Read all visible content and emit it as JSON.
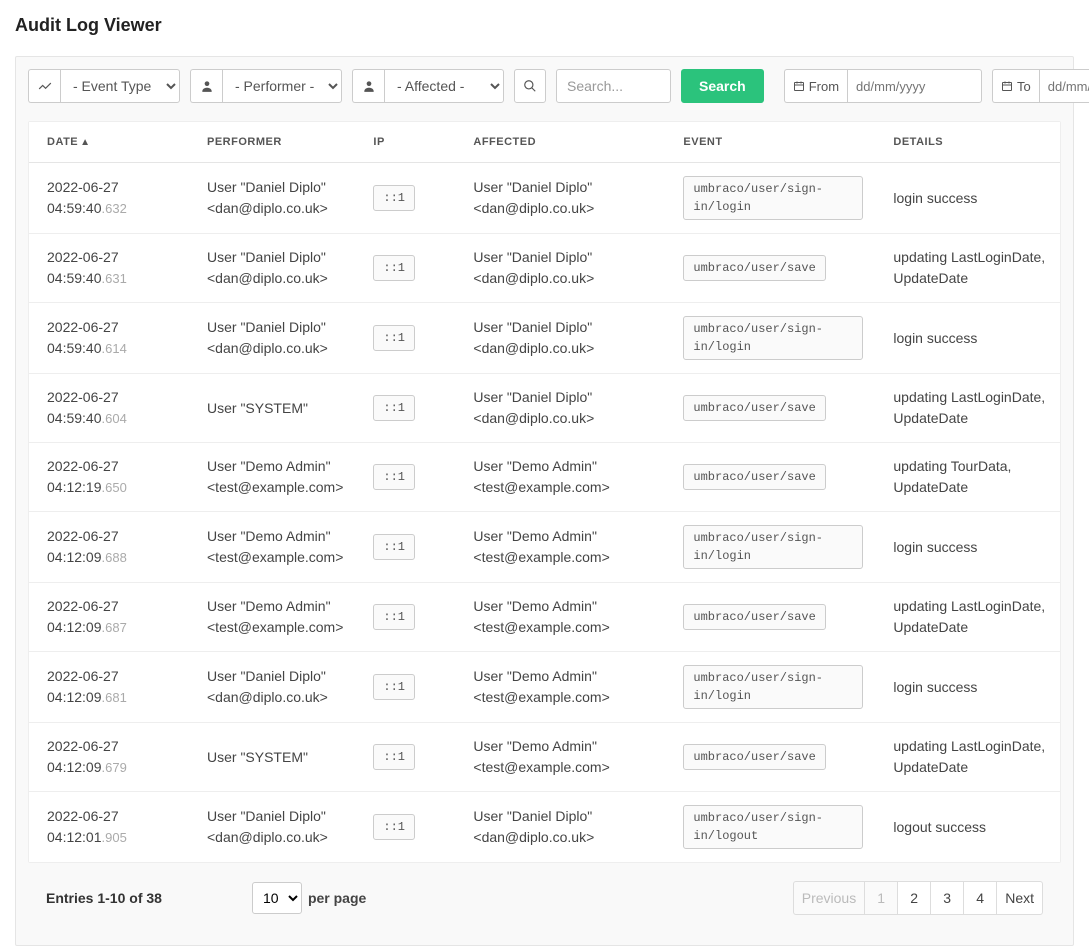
{
  "title": "Audit Log Viewer",
  "filters": {
    "eventType": "- Event Type -",
    "performer": "- Performer -",
    "affected": "- Affected -",
    "searchPlaceholder": "Search...",
    "searchButton": "Search",
    "fromLabel": "From",
    "toLabel": "To",
    "datePlaceholder": "dd/mm/yyyy"
  },
  "columns": {
    "date": "DATE",
    "performer": "PERFORMER",
    "ip": "IP",
    "affected": "AFFECTED",
    "event": "EVENT",
    "details": "DETAILS"
  },
  "rows": [
    {
      "date": "2022-06-27 04:59:40",
      "ms": ".632",
      "performer": "User \"Daniel Diplo\" <dan@diplo.co.uk>",
      "ip": "::1",
      "affected": "User \"Daniel Diplo\" <dan@diplo.co.uk>",
      "event": "umbraco/user/sign-in/login",
      "details": "login success"
    },
    {
      "date": "2022-06-27 04:59:40",
      "ms": ".631",
      "performer": "User \"Daniel Diplo\" <dan@diplo.co.uk>",
      "ip": "::1",
      "affected": "User \"Daniel Diplo\" <dan@diplo.co.uk>",
      "event": "umbraco/user/save",
      "details": "updating LastLoginDate, UpdateDate"
    },
    {
      "date": "2022-06-27 04:59:40",
      "ms": ".614",
      "performer": "User \"Daniel Diplo\" <dan@diplo.co.uk>",
      "ip": "::1",
      "affected": "User \"Daniel Diplo\" <dan@diplo.co.uk>",
      "event": "umbraco/user/sign-in/login",
      "details": "login success"
    },
    {
      "date": "2022-06-27 04:59:40",
      "ms": ".604",
      "performer": "User \"SYSTEM\"",
      "ip": "::1",
      "affected": "User \"Daniel Diplo\" <dan@diplo.co.uk>",
      "event": "umbraco/user/save",
      "details": "updating LastLoginDate, UpdateDate"
    },
    {
      "date": "2022-06-27 04:12:19",
      "ms": ".650",
      "performer": "User \"Demo Admin\" <test@example.com>",
      "ip": "::1",
      "affected": "User \"Demo Admin\" <test@example.com>",
      "event": "umbraco/user/save",
      "details": "updating TourData, UpdateDate"
    },
    {
      "date": "2022-06-27 04:12:09",
      "ms": ".688",
      "performer": "User \"Demo Admin\" <test@example.com>",
      "ip": "::1",
      "affected": "User \"Demo Admin\" <test@example.com>",
      "event": "umbraco/user/sign-in/login",
      "details": "login success"
    },
    {
      "date": "2022-06-27 04:12:09",
      "ms": ".687",
      "performer": "User \"Demo Admin\" <test@example.com>",
      "ip": "::1",
      "affected": "User \"Demo Admin\" <test@example.com>",
      "event": "umbraco/user/save",
      "details": "updating LastLoginDate, UpdateDate"
    },
    {
      "date": "2022-06-27 04:12:09",
      "ms": ".681",
      "performer": "User \"Daniel Diplo\" <dan@diplo.co.uk>",
      "ip": "::1",
      "affected": "User \"Demo Admin\" <test@example.com>",
      "event": "umbraco/user/sign-in/login",
      "details": "login success"
    },
    {
      "date": "2022-06-27 04:12:09",
      "ms": ".679",
      "performer": "User \"SYSTEM\"",
      "ip": "::1",
      "affected": "User \"Demo Admin\" <test@example.com>",
      "event": "umbraco/user/save",
      "details": "updating LastLoginDate, UpdateDate"
    },
    {
      "date": "2022-06-27 04:12:01",
      "ms": ".905",
      "performer": "User \"Daniel Diplo\" <dan@diplo.co.uk>",
      "ip": "::1",
      "affected": "User \"Daniel Diplo\" <dan@diplo.co.uk>",
      "event": "umbraco/user/sign-in/logout",
      "details": "logout success"
    }
  ],
  "footer": {
    "entries": "Entries 1-10 of 38",
    "perPageValue": "10",
    "perPageLabel": "per page",
    "prev": "Previous",
    "next": "Next",
    "pages": [
      "1",
      "2",
      "3",
      "4"
    ]
  }
}
